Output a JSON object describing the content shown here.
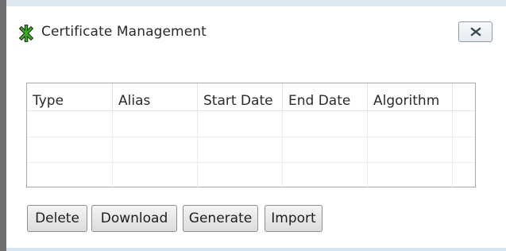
{
  "window": {
    "title": "Certificate Management",
    "icon": "certificate-app-icon",
    "close_icon": "close-icon"
  },
  "table": {
    "columns": [
      "Type",
      "Alias",
      "Start Date",
      "End Date",
      "Algorithm"
    ],
    "rows": [
      [
        "",
        "",
        "",
        "",
        ""
      ],
      [
        "",
        "",
        "",
        "",
        ""
      ],
      [
        "",
        "",
        "",
        "",
        ""
      ]
    ]
  },
  "buttons": {
    "delete": "Delete",
    "download": "Download",
    "generate": "Generate",
    "import": "Import"
  },
  "colors": {
    "title_icon_green": "#2e9d1e",
    "frame": "#dfe8f1"
  }
}
